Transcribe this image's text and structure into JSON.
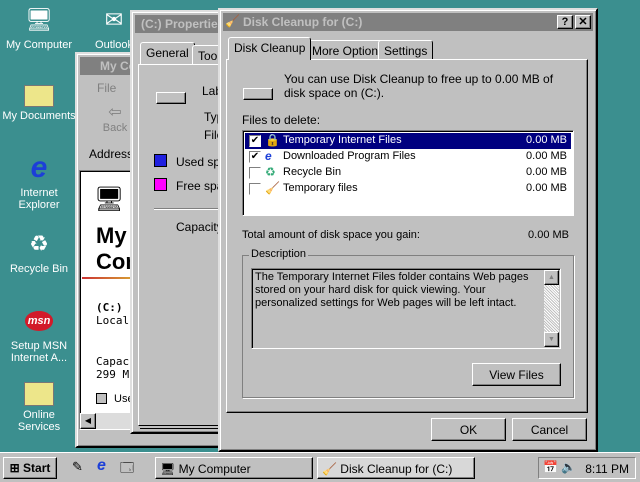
{
  "desktop": {
    "icons": [
      {
        "label": "My Computer",
        "icon": "computer-icon"
      },
      {
        "label": "Outlook",
        "icon": "outlook-icon"
      },
      {
        "label": "My Documents",
        "icon": "folder-icon"
      },
      {
        "label": "Internet Explorer",
        "icon": "ie-icon"
      },
      {
        "label": "Recycle Bin",
        "icon": "recycle-bin-icon"
      },
      {
        "label": "Setup MSN Internet A...",
        "icon": "msn-icon",
        "badge": "msn"
      },
      {
        "label": "Online Services",
        "icon": "folder-icon"
      }
    ]
  },
  "my_computer": {
    "title": "My Co",
    "menu_file": "File",
    "back": "Back",
    "address": "Address",
    "heading1": "My",
    "heading2": "Com",
    "drive": "(C:)",
    "drive_type": "Local I",
    "capacity": "Capac",
    "capacity_value": "299 M",
    "used": "Use"
  },
  "properties": {
    "title": "(C:) Properties",
    "tabs": [
      "General",
      "Tool"
    ],
    "label": "Lab",
    "type": "Typ",
    "file": "File",
    "used": "Used spa",
    "free": "Free spa",
    "capacity": "Capacity:",
    "used_color": "#2020e0",
    "free_color": "#ff00ff"
  },
  "cleanup": {
    "title": "Disk Cleanup for  (C:)",
    "help": "?",
    "close": "✕",
    "tabs": [
      "Disk Cleanup",
      "More Options",
      "Settings"
    ],
    "intro": "You can use Disk Cleanup to free up to 0.00 MB of disk space on  (C:).",
    "files_label": "Files to delete:",
    "files": [
      {
        "name": "Temporary Internet Files",
        "size": "0.00 MB",
        "checked": true,
        "selected": true,
        "icon": "lock-icon"
      },
      {
        "name": "Downloaded Program Files",
        "size": "0.00 MB",
        "checked": true,
        "icon": "ie-page-icon"
      },
      {
        "name": "Recycle Bin",
        "size": "0.00 MB",
        "checked": false,
        "icon": "recycle-bin-icon"
      },
      {
        "name": "Temporary files",
        "size": "0.00 MB",
        "checked": false,
        "icon": "cleanup-icon"
      }
    ],
    "total_label": "Total amount of disk space you gain:",
    "total_value": "0.00 MB",
    "description_label": "Description",
    "description": "The Temporary Internet Files folder contains Web pages stored on your hard disk for quick viewing. Your personalized settings for Web pages will be left intact.",
    "view_files": "View Files",
    "ok": "OK",
    "cancel": "Cancel"
  },
  "taskbar": {
    "start": "Start",
    "tasks": [
      "My Computer",
      "Disk Cleanup for  (C:)"
    ],
    "clock": "8:11 PM"
  }
}
